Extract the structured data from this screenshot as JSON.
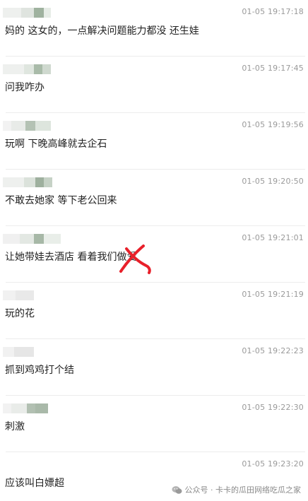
{
  "messages": [
    {
      "time": "01-05 19:17:18",
      "text": "妈的  这女的，一点解决问题能力都没   还生娃"
    },
    {
      "time": "01-05 19:17:45",
      "text": "问我咋办"
    },
    {
      "time": "01-05 19:19:56",
      "text": "玩啊  下晚高峰就去企石"
    },
    {
      "time": "01-05 19:20:50",
      "text": "不敢去她家  等下老公回来"
    },
    {
      "time": "01-05 19:21:01",
      "text": "让她带娃去酒店  看着我们做爱"
    },
    {
      "time": "01-05 19:21:19",
      "text": "玩的花"
    },
    {
      "time": "01-05 19:22:23",
      "text": "抓到鸡鸡打个结"
    },
    {
      "time": "01-05 19:22:30",
      "text": "刺激"
    },
    {
      "time": "01-05 19:23:20",
      "text": "应该叫白嫖超"
    }
  ],
  "watermark": {
    "text": "公众号 · 卡卡的瓜田网络吃瓜之家",
    "icon": "wechat-icon"
  },
  "colors": {
    "time": "#9a9a9a",
    "text": "#222222",
    "separator": "#ececec",
    "annotation": "#e8202a"
  }
}
